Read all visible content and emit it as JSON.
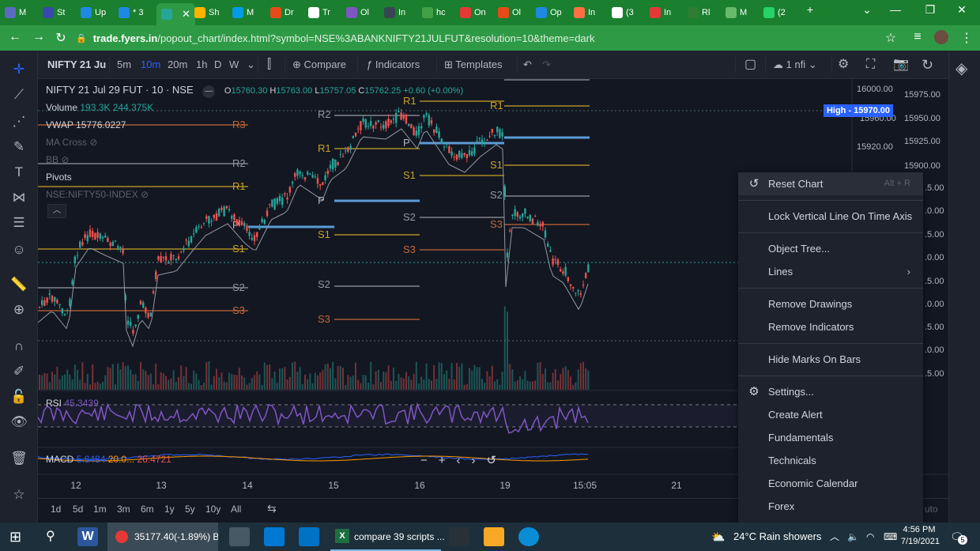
{
  "browser": {
    "tabs": [
      {
        "label": "M",
        "color": "#5c6bc0"
      },
      {
        "label": "St",
        "color": "#3949ab"
      },
      {
        "label": "Up",
        "color": "#1e88e5"
      },
      {
        "label": "* 3",
        "color": "#1e88e5"
      },
      {
        "label": "",
        "color": "#26a69a"
      },
      {
        "label": "Sh",
        "color": "#ffb300"
      },
      {
        "label": "M",
        "color": "#039be5"
      },
      {
        "label": "Dr",
        "color": "#e64a19"
      },
      {
        "label": "Tr",
        "color": "#ffffff"
      },
      {
        "label": "Ol",
        "color": "#7e57c2"
      },
      {
        "label": "In",
        "color": "#37474f"
      },
      {
        "label": "hc",
        "color": "#43a047"
      },
      {
        "label": "On",
        "color": "#e53935"
      },
      {
        "label": "Ol",
        "color": "#e64a19"
      },
      {
        "label": "Op",
        "color": "#1e88e5"
      },
      {
        "label": "In",
        "color": "#ff7043"
      },
      {
        "label": "(3",
        "color": "#ffffff"
      },
      {
        "label": "In",
        "color": "#e53935"
      },
      {
        "label": "Rl",
        "color": "#2e7d32"
      },
      {
        "label": "M",
        "color": "#66bb6a"
      },
      {
        "label": "(2",
        "color": "#25d366"
      }
    ],
    "new_tab": "+",
    "url_host": "trade.fyers.in",
    "url_path": "/popout_chart/index.html?symbol=NSE%3ABANKNIFTY21JULFUT&resolution=10&theme=dark"
  },
  "toolbar": {
    "symbol": "NIFTY 21 Ju",
    "intervals": [
      "5m",
      "10m",
      "20m",
      "1h",
      "D",
      "W"
    ],
    "active_interval": "10m",
    "compare": "Compare",
    "indicators": "Indicators",
    "templates": "Templates",
    "interval_selector": "1 nfi"
  },
  "legend": {
    "title": "NIFTY 21 Jul 29 FUT · 10 · NSE",
    "o_label": "O",
    "o_val": "15760.30",
    "h_label": "H",
    "h_val": "15763.00",
    "l_label": "L",
    "l_val": "15757.05",
    "c_label": "C",
    "c_val": "15762.25",
    "change": "+0.60 (+0.00%)",
    "volume_label": "Volume",
    "volume_v1": "193.3K",
    "volume_v2": "244.375K",
    "vwap_label": "VWAP",
    "vwap_val": "15776.0227",
    "ma_cross": "MA Cross",
    "bb": "BB",
    "pivots": "Pivots",
    "index": "NSE:NIFTY50-INDEX",
    "rsi_label": "RSI",
    "rsi_val": "45.3439",
    "macd_label": "MACD",
    "macd_v1": "5.8484",
    "macd_v2": "20.0...",
    "macd_v3": "26.4721"
  },
  "price_axis": {
    "labels": [
      "16000.00",
      "15975.00",
      "15960.00",
      "15950.00",
      "15920.00",
      "15925.00",
      "15900.00"
    ],
    "partial": [
      ".5.00",
      ".0.00",
      ".5.00",
      ".0.00",
      ".5.00",
      ".0.00",
      ".5.00",
      ".0.00",
      ".5.00"
    ],
    "high_label": "High - 15970.00"
  },
  "time_axis": {
    "labels": [
      "12",
      "13",
      "14",
      "15",
      "16",
      "19",
      "15:05",
      "21"
    ]
  },
  "pivot_labels": {
    "r1": "R1",
    "r2": "R2",
    "r3": "R3",
    "p": "P",
    "s1": "S1",
    "s2": "S2",
    "s3": "S3"
  },
  "range_bar": {
    "ranges": [
      "1d",
      "5d",
      "1m",
      "3m",
      "6m",
      "1y",
      "5y",
      "10y",
      "All"
    ],
    "auto": "uto"
  },
  "context_menu": {
    "reset": "Reset Chart",
    "reset_shortcut": "Alt + R",
    "lock": "Lock Vertical Line On Time Axis",
    "object_tree": "Object Tree...",
    "lines": "Lines",
    "remove_drawings": "Remove Drawings",
    "remove_indicators": "Remove Indicators",
    "hide_marks": "Hide Marks On Bars",
    "settings": "Settings...",
    "create_alert": "Create Alert",
    "fundamentals": "Fundamentals",
    "technicals": "Technicals",
    "economic_calendar": "Economic Calendar",
    "forex": "Forex"
  },
  "taskbar": {
    "chrome_title": "35177.40(-1.89%) B...",
    "excel_title": "compare 39 scripts ...",
    "weather": "24°C  Rain showers",
    "time": "4:56 PM",
    "date": "7/19/2021",
    "notifications": "5"
  },
  "colors": {
    "up": "#26a69a",
    "down": "#ef5350",
    "pivot_r1": "#c9a227",
    "pivot_p": "#5b9bd5",
    "pivot_r2": "#9598a1",
    "pivot_r3": "#c4663a",
    "rsi": "#7e57c2",
    "accent": "#2962ff"
  }
}
